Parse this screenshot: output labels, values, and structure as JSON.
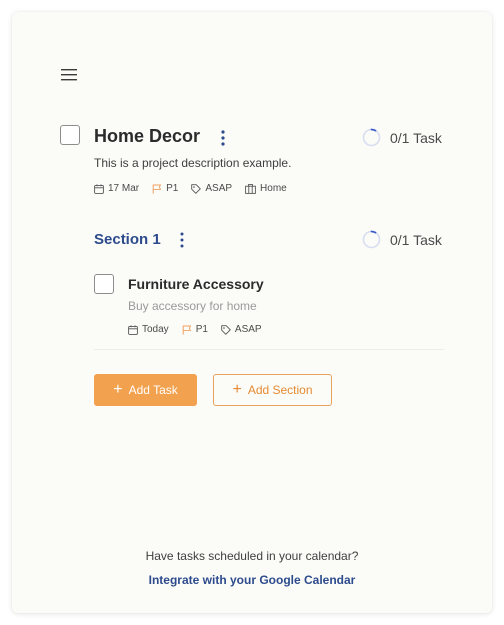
{
  "project": {
    "title": "Home Decor",
    "description": "This is a project description example.",
    "progress": "0/1 Task",
    "meta": {
      "date": "17 Mar",
      "priority": "P1",
      "tag": "ASAP",
      "location": "Home"
    }
  },
  "section": {
    "title": "Section 1",
    "progress": "0/1 Task"
  },
  "task": {
    "title": "Furniture Accessory",
    "description": "Buy accessory for home",
    "meta": {
      "date": "Today",
      "priority": "P1",
      "tag": "ASAP"
    }
  },
  "actions": {
    "add_task_plus": "+",
    "add_task": "Add Task",
    "add_section_plus": "+",
    "add_section": "Add Section"
  },
  "footer": {
    "prompt": "Have tasks scheduled in your calendar?",
    "link": "Integrate with your Google Calendar"
  },
  "icons": {
    "menu": "hamburger-menu-icon",
    "kebab": "kebab-menu-icon",
    "progress": "progress-ring-icon",
    "date": "calendar-icon",
    "priority": "flag-icon",
    "tag": "tag-icon",
    "location": "building-icon"
  },
  "colors": {
    "accent_orange": "#f2a14f",
    "link_blue": "#2c4a8c",
    "priority_flag": "#f0a060",
    "progress_ring": "#d8ddf0",
    "progress_arc": "#3a5ac8",
    "card_bg": "#fbfcf8"
  }
}
